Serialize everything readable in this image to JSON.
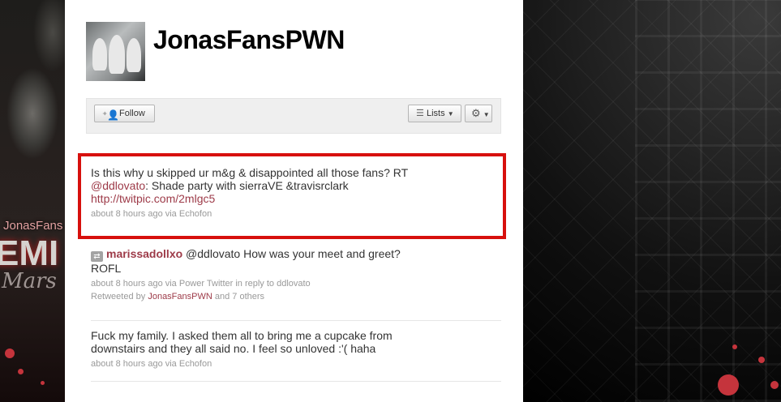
{
  "background": {
    "left_text": "JonasFans",
    "left_big_text": "EMI",
    "left_script_text": "Mars"
  },
  "profile": {
    "screen_name": "JonasFansPWN"
  },
  "actions": {
    "follow_label": "Follow",
    "lists_label": "Lists"
  },
  "tweets": [
    {
      "text_line1": "Is this why u skipped ur m&g & disappointed all those fans? RT",
      "mention": "@ddlovato",
      "text_line2_rest": ": Shade party with sierraVE &travisrclark",
      "link": "http://twitpic.com/2mlgc5",
      "meta": "about 8 hours ago via Echofon"
    },
    {
      "user": "marissadollxo",
      "text_part1": "@ddlovato How was your meet and greet?",
      "text_part2": "ROFL",
      "meta": "about 8 hours ago via Power Twitter in reply to ddlovato",
      "retweet_prefix": "Retweeted by",
      "retweet_user": "JonasFansPWN",
      "retweet_suffix": "and 7 others"
    },
    {
      "text_line1": "Fuck my family. I asked them all to bring me a cupcake from",
      "text_line2": "downstairs and they all said no. I feel so unloved :'( haha",
      "meta": "about 8 hours ago via Echofon"
    }
  ]
}
